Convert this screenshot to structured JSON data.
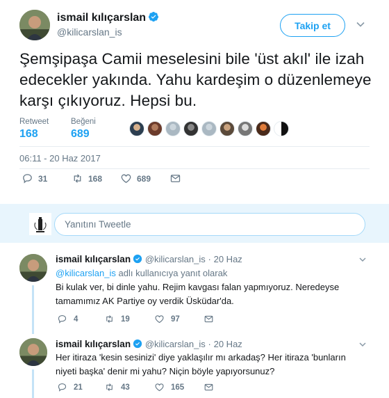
{
  "main_tweet": {
    "name": "ismail kılıçarslan",
    "handle": "@kilicarslan_is",
    "follow_label": "Takip et",
    "text": "Şemşipaşa Camii meselesini bile 'üst akıl' ile izah edecekler yakında. Yahu kardeşim o düzenlemeye karşı çıkıyoruz. Hepsi bu.",
    "retweet_label": "Retweet",
    "retweet_count": "168",
    "like_label": "Beğeni",
    "like_count": "689",
    "timestamp": "06:11 - 20 Haz 2017",
    "actions": {
      "reply": "31",
      "retweet": "168",
      "like": "689"
    }
  },
  "reply_box": {
    "placeholder": "Yanıtını Tweetle"
  },
  "replies": [
    {
      "name": "ismail kılıçarslan",
      "handle": "@kilicarslan_is",
      "separator": "·",
      "date": "20 Haz",
      "replying_to_mention": "@kilicarslan_is",
      "replying_to_suffix": "adlı kullanıcıya yanıt olarak",
      "text": "Bi kulak ver, bi dinle yahu. Rejim kavgası falan yapmıyoruz. Neredeyse tamamımız AK Partiye oy verdik Üsküdar'da.",
      "actions": {
        "reply": "4",
        "retweet": "19",
        "like": "97"
      }
    },
    {
      "name": "ismail kılıçarslan",
      "handle": "@kilicarslan_is",
      "separator": "·",
      "date": "20 Haz",
      "text": "Her itiraza 'kesin sesinizi' diye yaklaşılır mı arkadaş? Her itiraza 'bunların niyeti başka' denir mi yahu? Niçin böyle yapıyorsunuz?",
      "actions": {
        "reply": "21",
        "retweet": "43",
        "like": "165"
      }
    }
  ],
  "colors": {
    "accent": "#1da1f2",
    "muted": "#657786",
    "text": "#14171a",
    "reply_bg": "#e8f5fd",
    "like_stroke": "#657786"
  },
  "icons": [
    "verified-badge-icon",
    "chevron-down-icon",
    "reply-icon",
    "retweet-icon",
    "like-icon",
    "message-icon"
  ]
}
